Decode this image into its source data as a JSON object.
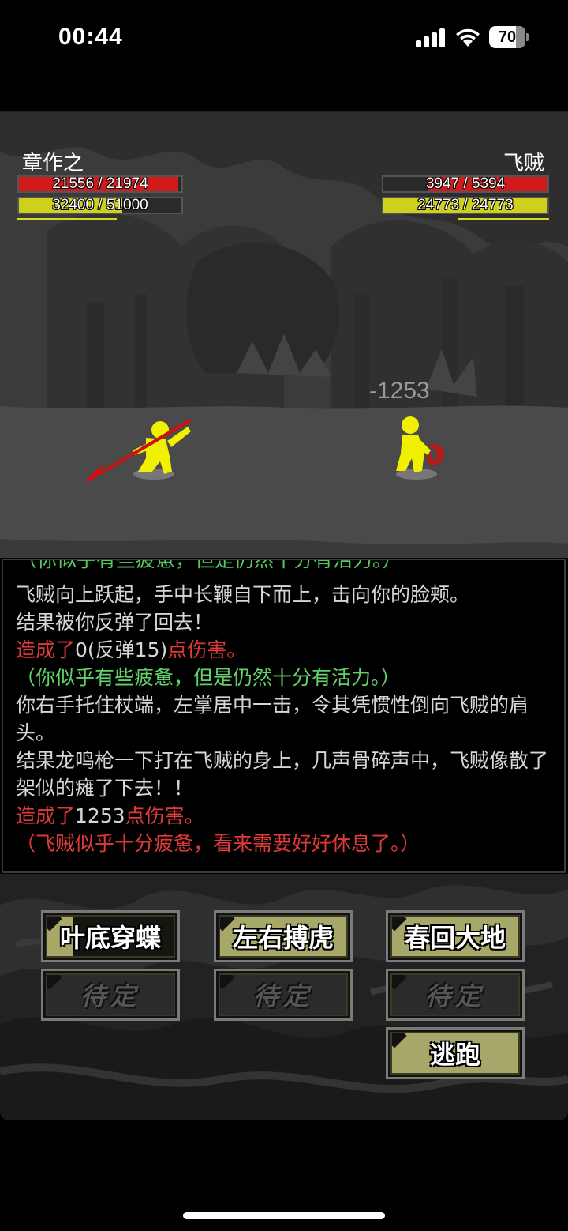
{
  "status_bar": {
    "time": "00:44",
    "battery": "70",
    "battery_level": 0.7
  },
  "player": {
    "name": "章作之",
    "hp_text": "21556 / 21974",
    "hp_fraction": 0.981,
    "mp_text": "32400 / 51000",
    "mp_fraction": 0.635
  },
  "enemy": {
    "name": "飞贼",
    "hp_text": "3947 / 5394",
    "hp_fraction": 0.732,
    "mp_text": "24773 / 24773",
    "mp_fraction": 1.0
  },
  "damage_popup": "-1253",
  "log": {
    "cut_line": "（你似乎有些疲惫，但是仍然十分有活力。）",
    "lines": [
      {
        "text": "飞贼向上跃起，手中长鞭自下而上，击向你的脸颊。"
      },
      {
        "text": "结果被你反弹了回去！"
      },
      {
        "prefix": "造成了",
        "value": "0(反弹15)",
        "suffix": "点伤害。"
      },
      {
        "green": "（你似乎有些疲惫，但是仍然十分有活力。）"
      },
      {
        "text": "你右手托住杖端，左掌居中一击，令其凭惯性倒向飞贼的肩头。"
      },
      {
        "text": "结果龙鸣枪一下打在飞贼的身上，几声骨碎声中，飞贼像散了架似的瘫了下去！！"
      },
      {
        "prefix": "造成了",
        "value": "1253",
        "suffix": "点伤害。"
      },
      {
        "red": "（飞贼似乎十分疲惫，看来需要好好休息了。）"
      }
    ]
  },
  "actions": {
    "skill1": "叶底穿蝶",
    "skill1_cooldown": 0.8,
    "skill2": "左右搏虎",
    "skill3": "春回大地",
    "slot4": "待定",
    "slot5": "待定",
    "slot6": "待定",
    "flee": "逃跑"
  },
  "colors": {
    "hp": "#d21a1a",
    "mp": "#cfcf1d",
    "button": "#a7a76a",
    "log_red": "#e03a3a",
    "log_green": "#62d06b",
    "character": "#f0f000"
  }
}
